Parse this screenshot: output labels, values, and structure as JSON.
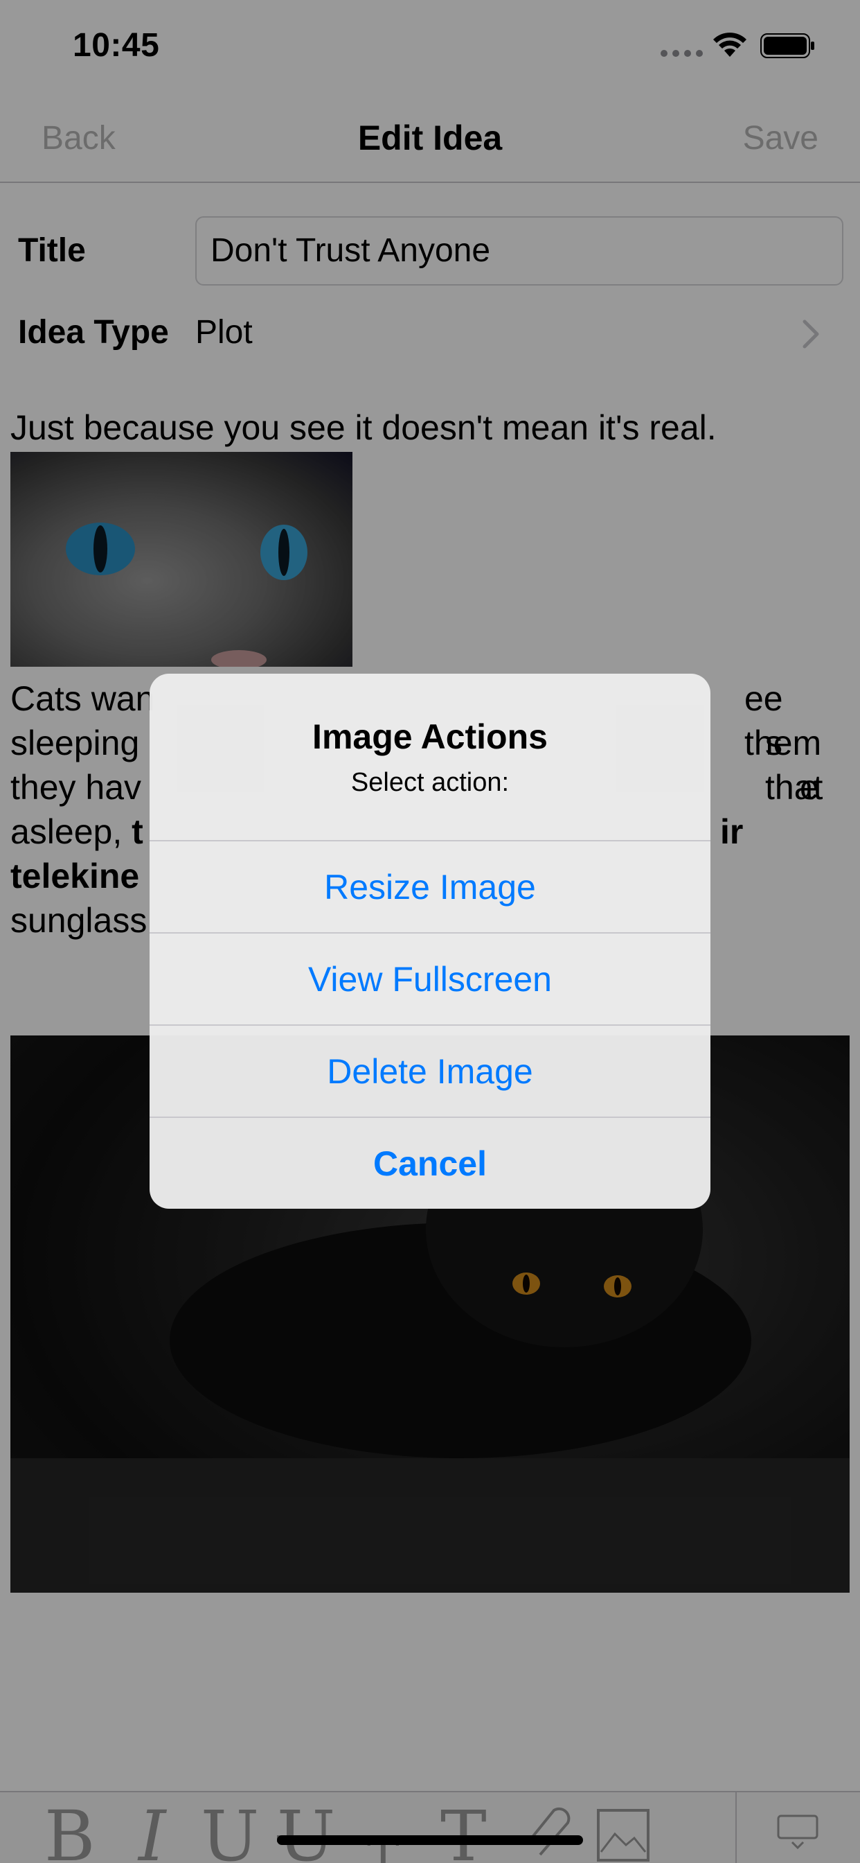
{
  "status_bar": {
    "time": "10:45"
  },
  "nav": {
    "back_label": "Back",
    "title": "Edit Idea",
    "save_label": "Save"
  },
  "form": {
    "title_label": "Title",
    "title_value": "Don't Trust Anyone",
    "type_label": "Idea Type",
    "type_value": "Plot"
  },
  "editor": {
    "paragraph1": "Just because you see it doesn't mean it's real.",
    "paragraph2_lines": [
      "Cats wan",
      "sleeping",
      "they hav",
      "asleep, "
    ],
    "paragraph2_right_lines": [
      "ee them",
      "s that",
      "e",
      "ir"
    ],
    "bold_fragments": [
      "t",
      "telekine"
    ],
    "last_line": "sunglass"
  },
  "toolbar": {
    "items": [
      "B",
      "I",
      "U",
      "U",
      "T",
      "T",
      "link-icon",
      "image-icon",
      "keyboard-icon"
    ]
  },
  "alert": {
    "title": "Image Actions",
    "message": "Select action:",
    "actions": [
      "Resize Image",
      "View Fullscreen",
      "Delete Image"
    ],
    "cancel": "Cancel",
    "action_color": "#007aff"
  }
}
